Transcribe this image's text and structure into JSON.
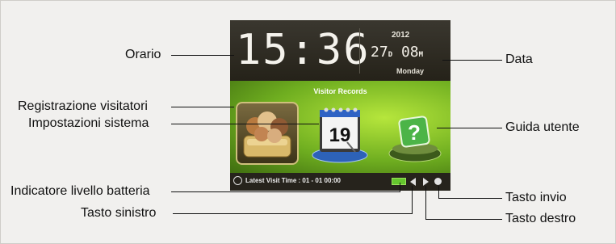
{
  "device": {
    "time": "15:36",
    "year": "2012",
    "day": "27",
    "day_unit": "D",
    "month": "08",
    "month_unit": "M",
    "weekday": "Monday",
    "menu_title": "Visitor Records",
    "calendar_number": "19",
    "help_symbol": "?",
    "latest_visit": "Latest Visit Time : 01 - 01 00:00"
  },
  "callouts": {
    "clock": "Orario",
    "date": "Data",
    "visitor_registration": "Registrazione visitatori",
    "system_settings": "Impostazioni sistema",
    "user_guide": "Guida utente",
    "battery_indicator": "Indicatore livello batteria",
    "left_key": "Tasto sinistro",
    "enter_key": "Tasto invio",
    "right_key": "Tasto destro"
  },
  "colors": {
    "menu_green": "#8cc832",
    "battery_green": "#65c62e",
    "calendar_blue": "#2d62b8"
  }
}
